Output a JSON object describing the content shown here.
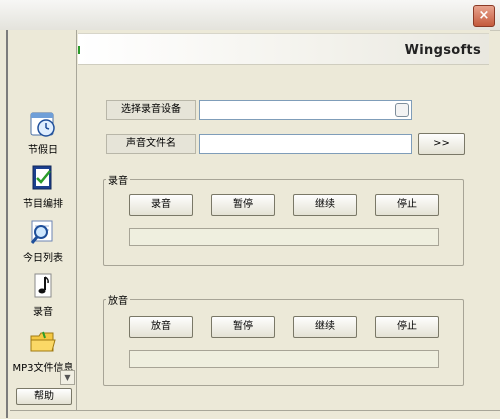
{
  "window": {
    "close_label": "×"
  },
  "brand": "Wingsofts",
  "sidebar": {
    "items": [
      {
        "label": "节假日",
        "icon": "stopwatch-icon"
      },
      {
        "label": "节目编排",
        "icon": "notepad-icon"
      },
      {
        "label": "今日列表",
        "icon": "search-document-icon"
      },
      {
        "label": "录音",
        "icon": "music-note-icon"
      },
      {
        "label": "MP3文件信息",
        "icon": "folder-icon"
      }
    ],
    "help_label": "帮助",
    "scroll_icon": "chevron-down-icon"
  },
  "form": {
    "device_label": "选择录音设备",
    "device_value": "",
    "filename_label": "声音文件名",
    "filename_value": "",
    "browse_label": ">>"
  },
  "record_group": {
    "title": "录音",
    "buttons": [
      "录音",
      "暂停",
      "继续",
      "停止"
    ]
  },
  "play_group": {
    "title": "放音",
    "buttons": [
      "放音",
      "暂停",
      "继续",
      "停止"
    ]
  },
  "colors": {
    "accent_green": "#2b9c2b",
    "field_border": "#7f9db9",
    "window_bg": "#ece9d8"
  }
}
